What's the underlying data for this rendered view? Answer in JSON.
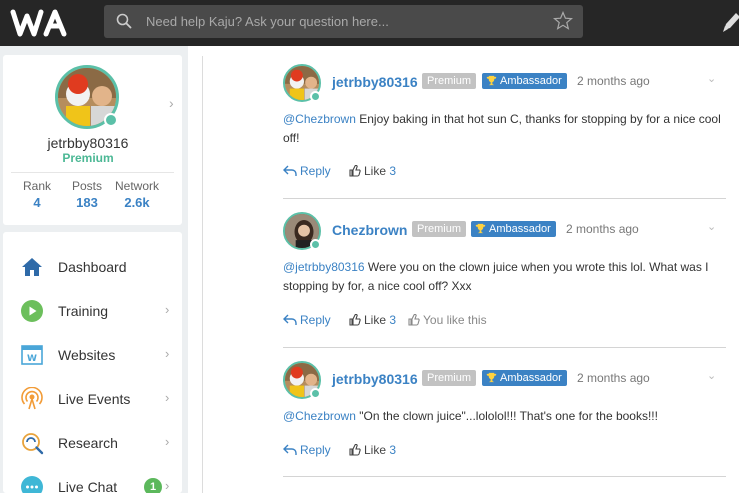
{
  "header": {
    "search_placeholder": "Need help Kaju? Ask your question here...",
    "logo": "wa-logo",
    "icons": [
      "search-icon",
      "star-icon",
      "pencil-icon"
    ]
  },
  "profile": {
    "username": "jetrbby80316",
    "membership": "Premium",
    "stats": [
      {
        "label": "Rank",
        "value": "4"
      },
      {
        "label": "Posts",
        "value": "183"
      },
      {
        "label": "Network",
        "value": "2.6k"
      }
    ]
  },
  "nav": {
    "items": [
      {
        "label": "Dashboard",
        "icon": "house-icon"
      },
      {
        "label": "Training",
        "icon": "play-icon"
      },
      {
        "label": "Websites",
        "icon": "websites-icon"
      },
      {
        "label": "Live Events",
        "icon": "broadcast-icon"
      },
      {
        "label": "Research",
        "icon": "research-icon"
      },
      {
        "label": "Live Chat",
        "icon": "chat-icon",
        "badge": "1"
      }
    ]
  },
  "comments": [
    {
      "author": "jetrbby80316",
      "badges": [
        "Premium",
        "Ambassador"
      ],
      "time": "2 months ago",
      "mention": "@Chezbrown",
      "text": " Enjoy baking in that hot sun C, thanks for stopping by for a nice cool off!",
      "reply_label": "Reply",
      "like_label": "Like",
      "like_count": "3"
    },
    {
      "author": "Chezbrown",
      "badges": [
        "Premium",
        "Ambassador"
      ],
      "time": "2 months ago",
      "mention": "@jetrbby80316",
      "text": " Were you on the clown juice when you wrote this lol. What was I stopping by for, a nice cool off? Xxx",
      "reply_label": "Reply",
      "like_label": "Like",
      "like_count": "3",
      "you_like_label": "You like this"
    },
    {
      "author": "jetrbby80316",
      "badges": [
        "Premium",
        "Ambassador"
      ],
      "time": "2 months ago",
      "mention": "@Chezbrown",
      "text": " \"On the clown juice\"...lololol!!! That's one for the books!!!",
      "reply_label": "Reply",
      "like_label": "Like",
      "like_count": "3"
    }
  ],
  "colors": {
    "accent_blue": "#3b82c4",
    "premium_green": "#4cb895",
    "topbar": "#262626"
  }
}
